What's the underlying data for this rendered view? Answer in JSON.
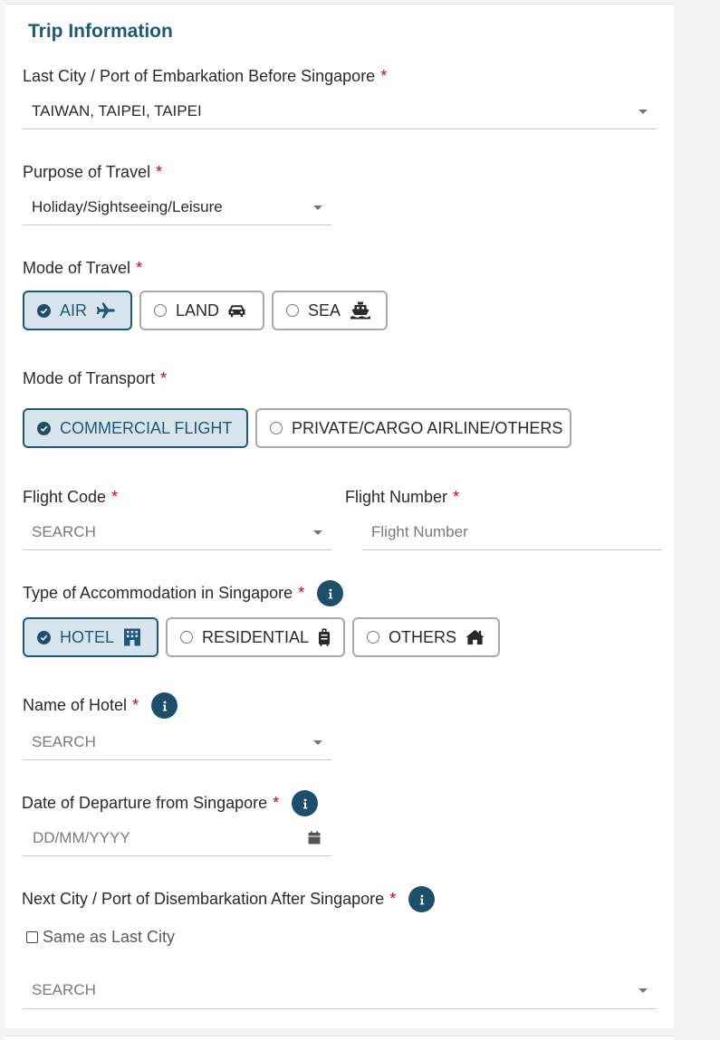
{
  "section": {
    "title": "Trip Information"
  },
  "last_city": {
    "label": "Last City / Port of Embarkation Before Singapore",
    "required": "*",
    "value": "TAIWAN, TAIPEI, TAIPEI"
  },
  "purpose": {
    "label": "Purpose of Travel",
    "required": "*",
    "value": "Holiday/Sightseeing/Leisure"
  },
  "mode_of_travel": {
    "label": "Mode of Travel",
    "required": "*",
    "options": [
      {
        "label": "AIR",
        "icon": "plane-icon",
        "selected": true
      },
      {
        "label": "LAND",
        "icon": "car-icon",
        "selected": false
      },
      {
        "label": "SEA",
        "icon": "ship-icon",
        "selected": false
      }
    ]
  },
  "mode_of_transport": {
    "label": "Mode of Transport",
    "required": "*",
    "options": [
      {
        "label": "COMMERCIAL FLIGHT",
        "selected": true
      },
      {
        "label": "PRIVATE/CARGO AIRLINE/OTHERS",
        "selected": false
      }
    ]
  },
  "flight_code": {
    "label": "Flight Code",
    "required": "*",
    "placeholder": "SEARCH"
  },
  "flight_number": {
    "label": "Flight Number",
    "required": "*",
    "placeholder": "Flight Number"
  },
  "accommodation": {
    "label": "Type of Accommodation in Singapore",
    "required": "*",
    "info_icon": "info-icon",
    "options": [
      {
        "label": "HOTEL",
        "icon": "building-icon",
        "selected": true
      },
      {
        "label": "RESIDENTIAL",
        "icon": "suitcase-icon",
        "selected": false
      },
      {
        "label": "OTHERS",
        "icon": "home-icon",
        "selected": false
      }
    ]
  },
  "hotel_name": {
    "label": "Name of Hotel",
    "required": "*",
    "placeholder": "SEARCH",
    "info_icon": "info-icon"
  },
  "departure_date": {
    "label": "Date of Departure from Singapore",
    "required": "*",
    "placeholder": "DD/MM/YYYY",
    "icon": "calendar-icon",
    "info_icon": "info-icon"
  },
  "next_city": {
    "label": "Next City / Port of Disembarkation After Singapore",
    "required": "*",
    "info_icon": "info-icon",
    "same_as_last": "Same as Last City",
    "same_as_last_checked": false,
    "placeholder": "SEARCH"
  },
  "colors": {
    "primary": "#1d5a78",
    "selected_bg": "#d8e4ec",
    "required": "#d0021b",
    "border": "#a9a9a9"
  }
}
